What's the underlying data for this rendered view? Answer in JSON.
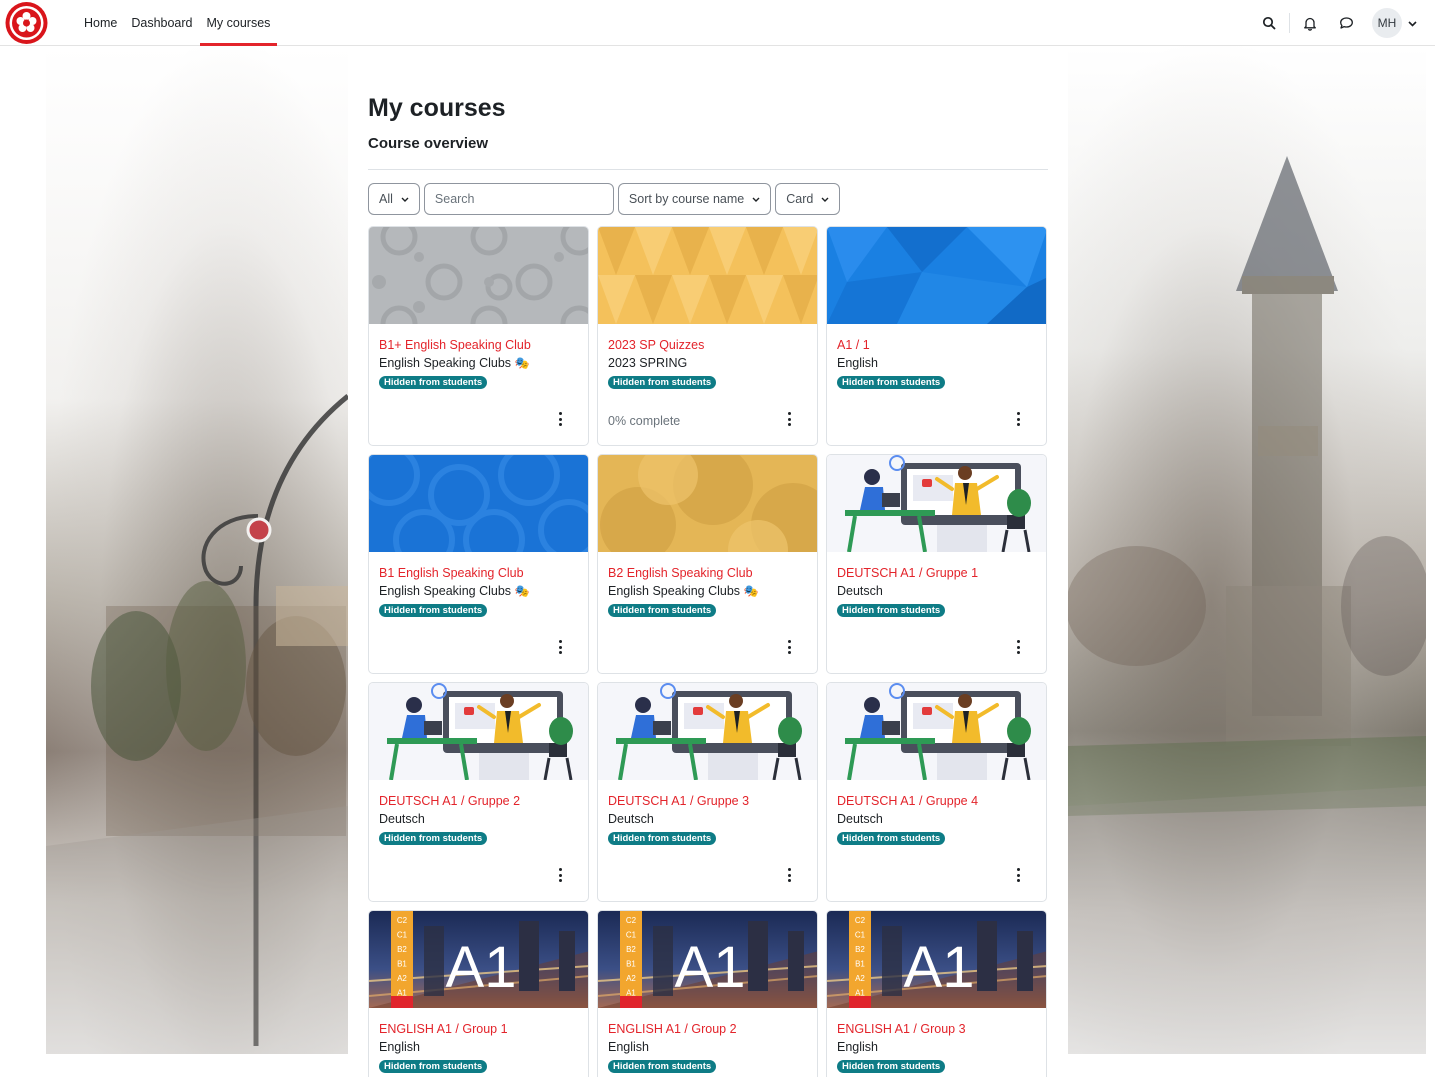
{
  "nav": {
    "links": [
      {
        "label": "Home",
        "active": false
      },
      {
        "label": "Dashboard",
        "active": false
      },
      {
        "label": "My courses",
        "active": true
      }
    ],
    "user_initials": "MH",
    "accent": "#e3242b"
  },
  "page": {
    "title": "My courses",
    "section": "Course overview"
  },
  "controls": {
    "grouping": "All",
    "search_placeholder": "Search",
    "sort": "Sort by course name",
    "view": "Card"
  },
  "courses": [
    {
      "name": "B1+ English Speaking Club",
      "category": "English Speaking Clubs",
      "emoji": "🎭",
      "badge": "Hidden from students",
      "progress": "",
      "image": "grey-circles"
    },
    {
      "name": "2023 SP Quizzes",
      "category": "2023 SPRING",
      "emoji": "",
      "badge": "Hidden from students",
      "progress": "0% complete",
      "image": "yellow-triangles"
    },
    {
      "name": "A1 / 1",
      "category": "English",
      "emoji": "",
      "badge": "Hidden from students",
      "progress": "",
      "image": "blue-polygons"
    },
    {
      "name": "B1 English Speaking Club",
      "category": "English Speaking Clubs",
      "emoji": "🎭",
      "badge": "Hidden from students",
      "progress": "",
      "image": "blue-circles"
    },
    {
      "name": "B2 English Speaking Club",
      "category": "English Speaking Clubs",
      "emoji": "🎭",
      "badge": "Hidden from students",
      "progress": "",
      "image": "gold-circles"
    },
    {
      "name": "DEUTSCH A1 / Gruppe 1",
      "category": "Deutsch",
      "emoji": "",
      "badge": "Hidden from students",
      "progress": "",
      "image": "online-class"
    },
    {
      "name": "DEUTSCH A1 / Gruppe 2",
      "category": "Deutsch",
      "emoji": "",
      "badge": "Hidden from students",
      "progress": "",
      "image": "online-class"
    },
    {
      "name": "DEUTSCH A1 / Gruppe 3",
      "category": "Deutsch",
      "emoji": "",
      "badge": "Hidden from students",
      "progress": "",
      "image": "online-class"
    },
    {
      "name": "DEUTSCH A1 / Gruppe 4",
      "category": "Deutsch",
      "emoji": "",
      "badge": "Hidden from students",
      "progress": "",
      "image": "online-class"
    },
    {
      "name": "ENGLISH A1 / Group 1",
      "category": "English",
      "emoji": "",
      "badge": "Hidden from students",
      "progress": "",
      "image": "a1-london"
    },
    {
      "name": "ENGLISH A1 / Group 2",
      "category": "English",
      "emoji": "",
      "badge": "Hidden from students",
      "progress": "",
      "image": "a1-london"
    },
    {
      "name": "ENGLISH A1 / Group 3",
      "category": "English",
      "emoji": "",
      "badge": "Hidden from students",
      "progress": "",
      "image": "a1-london"
    }
  ],
  "a1_image": {
    "big_label": "A1",
    "levels": [
      "C2",
      "C1",
      "B2",
      "B1",
      "A2",
      "A1"
    ]
  }
}
